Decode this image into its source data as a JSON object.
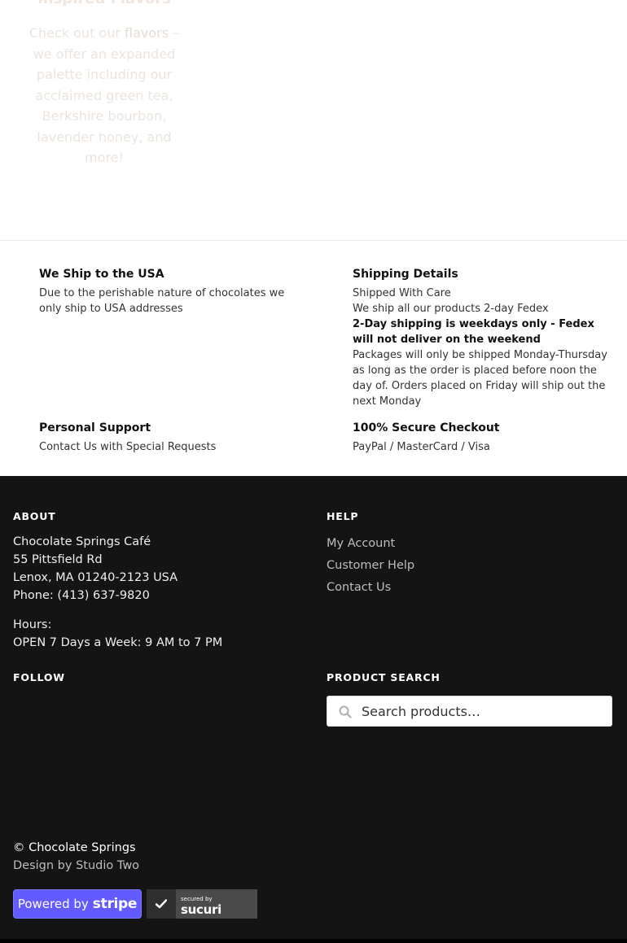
{
  "promo": {
    "title": "Inspired Flavors",
    "text_before": "Check out our ",
    "link": "flavors",
    "text_after": " – we offer an expanded palette including our acclaimed green tea, Berkshire bourbon, lavender honey, and more!"
  },
  "features": [
    {
      "title": "We Ship to the USA",
      "lines": [
        "Due to the perishable nature of chocolates we only ship to USA addresses"
      ]
    },
    {
      "title": "Shipping Details",
      "lines": [
        "Shipped With Care",
        "We ship all our products 2-day Fedex",
        "2-Day shipping is weekdays only - Fedex will not deliver on the weekend",
        "Packages will only be shipped Monday-Thursday as long as the order is placed before noon the day of. Orders placed on Friday will ship out the next Monday"
      ]
    },
    {
      "title": "Personal Support",
      "lines": [
        "Contact Us with Special Requests"
      ]
    },
    {
      "title": "100% Secure Checkout",
      "lines": [
        "PayPal / MasterCard / Visa"
      ]
    }
  ],
  "footer": {
    "about": {
      "heading": "ABOUT",
      "name": "Chocolate Springs Café",
      "street": "55 Pittsfield Rd",
      "city": "Lenox, MA 01240-2123 USA",
      "phone": "Phone: (413) 637-9820",
      "hours_label": "Hours:",
      "hours": "OPEN 7 Days a Week: 9 AM to 7 PM"
    },
    "help": {
      "heading": "HELP",
      "links": [
        "My Account",
        "Customer Help",
        "Contact Us"
      ]
    },
    "follow": {
      "heading": "FOLLOW"
    },
    "search": {
      "heading": "PRODUCT SEARCH",
      "placeholder": "Search products…"
    },
    "copyright": "© Chocolate Springs",
    "design": "Design by Studio Two",
    "badges": {
      "stripe_prefix": "Powered by",
      "stripe_word": "stripe",
      "sucuri_small": "secured by",
      "sucuri_brand": "sucuri"
    }
  },
  "colors": {
    "footer_bg": "#151415",
    "stripe": "#635bff"
  }
}
